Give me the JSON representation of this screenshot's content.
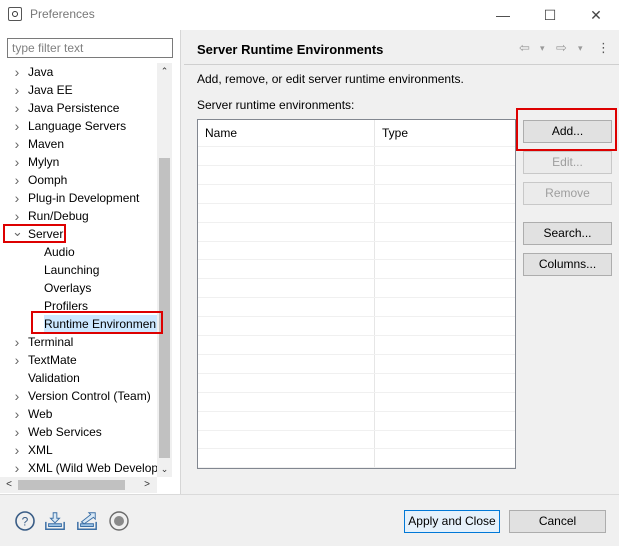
{
  "window": {
    "title": "Preferences",
    "minimize": "—",
    "maximize": "☐",
    "close": "✕"
  },
  "filter": {
    "placeholder": "type filter text",
    "value": ""
  },
  "tree": {
    "items": [
      {
        "label": "Java",
        "arrow": "›",
        "level": 0
      },
      {
        "label": "Java EE",
        "arrow": "›",
        "level": 0
      },
      {
        "label": "Java Persistence",
        "arrow": "›",
        "level": 0
      },
      {
        "label": "Language Servers",
        "arrow": "›",
        "level": 0
      },
      {
        "label": "Maven",
        "arrow": "›",
        "level": 0
      },
      {
        "label": "Mylyn",
        "arrow": "›",
        "level": 0
      },
      {
        "label": "Oomph",
        "arrow": "›",
        "level": 0
      },
      {
        "label": "Plug-in Development",
        "arrow": "›",
        "level": 0
      },
      {
        "label": "Run/Debug",
        "arrow": "›",
        "level": 0
      },
      {
        "label": "Server",
        "arrow": "⌄",
        "level": 0,
        "expanded": true
      },
      {
        "label": "Audio",
        "arrow": "",
        "level": 1
      },
      {
        "label": "Launching",
        "arrow": "",
        "level": 1
      },
      {
        "label": "Overlays",
        "arrow": "",
        "level": 1
      },
      {
        "label": "Profilers",
        "arrow": "",
        "level": 1
      },
      {
        "label": "Runtime Environmen",
        "arrow": "",
        "level": 1,
        "selected": true
      },
      {
        "label": "Terminal",
        "arrow": "›",
        "level": 0
      },
      {
        "label": "TextMate",
        "arrow": "›",
        "level": 0
      },
      {
        "label": "Validation",
        "arrow": "",
        "level": 0
      },
      {
        "label": "Version Control (Team)",
        "arrow": "›",
        "level": 0
      },
      {
        "label": "Web",
        "arrow": "›",
        "level": 0
      },
      {
        "label": "Web Services",
        "arrow": "›",
        "level": 0
      },
      {
        "label": "XML",
        "arrow": "›",
        "level": 0
      },
      {
        "label": "XML (Wild Web Develop",
        "arrow": "›",
        "level": 0
      }
    ],
    "scroll_up": "⌃",
    "scroll_down": "⌄",
    "scroll_left": "<",
    "scroll_right": ">"
  },
  "page": {
    "title": "Server Runtime Environments",
    "back_icon": "⇦",
    "forward_icon": "⇨",
    "menu_icon": "⋮",
    "dropdown": "▾",
    "description": "Add, remove, or edit server runtime environments.",
    "table_label": "Server runtime environments:",
    "columns": [
      "Name",
      "Type"
    ]
  },
  "buttons": {
    "add": "Add...",
    "edit": "Edit...",
    "remove": "Remove",
    "search": "Search...",
    "columns": "Columns..."
  },
  "footer": {
    "help_icon": "?",
    "apply_close": "Apply and Close",
    "cancel": "Cancel"
  },
  "colors": {
    "highlight": "#dd0000",
    "selection_row": "#cce8ff"
  }
}
